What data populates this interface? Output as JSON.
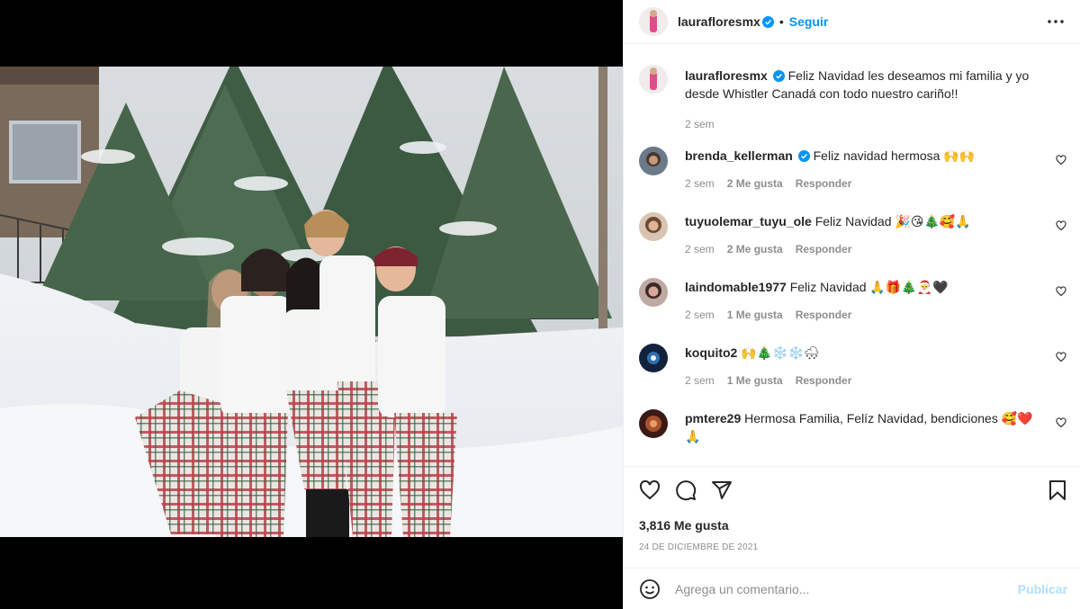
{
  "post": {
    "author": "lauraflores​mx",
    "follow_label": "Seguir",
    "separator": "•",
    "caption": "Feliz Navidad les deseamos mi familia y yo desde Whistler Canadá con todo nuestro cariño!!",
    "caption_time": "2 sem",
    "likes": "3,816 Me gusta",
    "date": "24 DE DICIEMBRE DE 2021"
  },
  "comments": [
    {
      "user": "brenda_kellerman",
      "verified": true,
      "text": "Feliz navidad hermosa 🙌🙌",
      "time": "2 sem",
      "likes": "2 Me gusta",
      "reply": "Responder"
    },
    {
      "user": "tuyuolemar_tuyu_ole",
      "verified": false,
      "text": "Feliz Navidad 🎉😘🎄🥰🙏",
      "time": "2 sem",
      "likes": "2 Me gusta",
      "reply": "Responder"
    },
    {
      "user": "laindomable1977",
      "verified": false,
      "text": "Feliz Navidad 🙏🎁🎄🎅🖤",
      "time": "2 sem",
      "likes": "1 Me gusta",
      "reply": "Responder"
    },
    {
      "user": "koquito2",
      "verified": false,
      "text": "🙌🎄❄️❄️🌨",
      "time": "2 sem",
      "likes": "1 Me gusta",
      "reply": "Responder"
    },
    {
      "user": "pmtere29",
      "verified": false,
      "text": "Hermosa Familia, Felíz Navidad, bendiciones 🥰❤️ 🙏",
      "time": "",
      "likes": "",
      "reply": ""
    }
  ],
  "add_comment": {
    "placeholder": "Agrega un comentario...",
    "publish_label": "Publicar"
  },
  "colors": {
    "accent": "#0095f6",
    "publish_disabled": "#b2dffc",
    "muted": "#8e8e8e"
  },
  "icons": [
    "more-options-icon",
    "verified-badge-icon",
    "heart-icon",
    "comment-icon",
    "share-icon",
    "bookmark-icon",
    "emoji-icon"
  ]
}
